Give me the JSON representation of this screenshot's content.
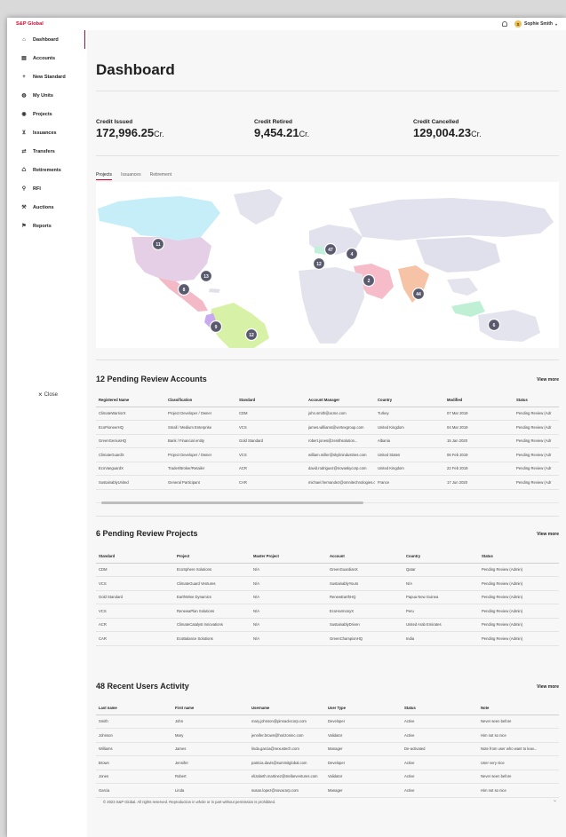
{
  "header": {
    "brand": "S&P Global",
    "user_initial": "S",
    "user_name": "Sophie Smith",
    "caret": "▾"
  },
  "sidebar": {
    "items": [
      {
        "label": "Dashboard",
        "icon": "home-icon",
        "glyph": "⌂"
      },
      {
        "label": "Accounts",
        "icon": "accounts-icon",
        "glyph": "▤"
      },
      {
        "label": "New Standard",
        "icon": "plus-icon",
        "glyph": "+"
      },
      {
        "label": "My Units",
        "icon": "units-icon",
        "glyph": "◍"
      },
      {
        "label": "Projects",
        "icon": "projects-icon",
        "glyph": "◉"
      },
      {
        "label": "Issuances",
        "icon": "cart-icon",
        "glyph": "⊻"
      },
      {
        "label": "Transfers",
        "icon": "transfer-icon",
        "glyph": "⇄"
      },
      {
        "label": "Retirements",
        "icon": "recycle-icon",
        "glyph": "♺"
      },
      {
        "label": "RFI",
        "icon": "rfi-icon",
        "glyph": "⚲"
      },
      {
        "label": "Auctions",
        "icon": "gavel-icon",
        "glyph": "⚒"
      },
      {
        "label": "Reports",
        "icon": "flag-icon",
        "glyph": "⚑"
      }
    ],
    "close_label": "Close"
  },
  "main": {
    "title": "Dashboard",
    "stats": [
      {
        "label": "Credit Issued",
        "value": "172,996.25",
        "unit": "Cr."
      },
      {
        "label": "Credit Retired",
        "value": "9,454.21",
        "unit": "Cr."
      },
      {
        "label": "Credit Cancelled",
        "value": "129,004.23",
        "unit": "Cr."
      }
    ],
    "tabs": [
      "Projects",
      "Issuances",
      "Retirement"
    ],
    "map_markers": [
      {
        "label": "11"
      },
      {
        "label": "13"
      },
      {
        "label": "8"
      },
      {
        "label": "9"
      },
      {
        "label": "12"
      },
      {
        "label": "47"
      },
      {
        "label": "4"
      },
      {
        "label": "12"
      },
      {
        "label": "2"
      },
      {
        "label": "44"
      },
      {
        "label": "6"
      }
    ]
  },
  "accounts": {
    "title": "12 Pending Review Accounts",
    "view_more": "View more",
    "columns": [
      "Registered Name",
      "Classification",
      "Standard",
      "Account Manager",
      "Country",
      "Modified",
      "Status"
    ],
    "rows": [
      [
        "ClimateWarriorX",
        "Project Developer / Owner",
        "CDM",
        "john.smith@acme.com",
        "Turkey",
        "07 Mar 2019",
        "Pending Review (Adr"
      ],
      [
        "EcoPioneerHQ",
        "Small / Medium Enterprise",
        "VCS",
        "james.williams@vertexgroup.com",
        "United Kingdom",
        "04 Mar 2019",
        "Pending Review (Adr"
      ],
      [
        "GreenGeniusHQ",
        "Bank / Financial entity",
        "Gold Standard",
        "robert.jones@zenithsolution...",
        "Albania",
        "15 Jan 2020",
        "Pending Review (Adr"
      ],
      [
        "ClimateGuardX",
        "Project Developer / Owner",
        "VCS",
        "william.miller@skylinindustries.com",
        "United States",
        "06 Feb 2019",
        "Pending Review (Adr"
      ],
      [
        "EcoVanguardX",
        "Trader/Broker/Retailer",
        "ACR",
        "david.rodriguez@novaskycorp.com",
        "United Kingdom",
        "22 Feb 2019",
        "Pending Review (Adr"
      ],
      [
        "SustainablyUnited",
        "General Participant",
        "CAR",
        "michael.hernandez@omnitechnologies.com",
        "France",
        "17 Jun 2020",
        "Pending Review (Adr"
      ]
    ]
  },
  "projects": {
    "title": "6 Pending Review Projects",
    "view_more": "View more",
    "columns": [
      "Standard",
      "Project",
      "Master Project",
      "Account",
      "Country",
      "Status"
    ],
    "rows": [
      [
        "CDM",
        "EcoSphere Solutions",
        "N/A",
        "GreenGuardianX",
        "Qatar",
        "Pending Review (Admin)"
      ],
      [
        "VCS",
        "ClimateGuard Ventures",
        "N/A",
        "SustainablyYours",
        "N/A",
        "Pending Review (Admin)"
      ],
      [
        "Gold Standard",
        "EarthWise Dynamics",
        "N/A",
        "RenewEarthHQ",
        "Papua New Guinea",
        "Pending Review (Admin)"
      ],
      [
        "VCS",
        "RenewaPlan Solutions",
        "N/A",
        "EcoHarmonyX",
        "Peru",
        "Pending Review (Admin)"
      ],
      [
        "ACR",
        "ClimateCatalyst Innovations",
        "N/A",
        "SustainablyDriven",
        "United Arab Emirates",
        "Pending Review (Admin)"
      ],
      [
        "CAR",
        "EcoBalance Solutions",
        "N/A",
        "GreenChampionHQ",
        "India",
        "Pending Review (Admin)"
      ]
    ]
  },
  "users": {
    "title": "48 Recent Users Activity",
    "view_more": "View more",
    "columns": [
      "Last name",
      "First name",
      "Username",
      "User Type",
      "Status",
      "Note"
    ],
    "rows": [
      [
        "Smith",
        "John",
        "mary.johnson@pinnaclecorp.com",
        "Developer",
        "Active",
        "Never seen before"
      ],
      [
        "Johnson",
        "Mary",
        "jennifer.brown@horizoninc.com",
        "Validator",
        "Active",
        "Him not so nice"
      ],
      [
        "Williams",
        "James",
        "linda.garcia@nexustech.com",
        "Manager",
        "De-activated",
        "Note from user who want to leav..."
      ],
      [
        "Brown",
        "Jennifer",
        "patricia.davis@summitglobal.com",
        "Developer",
        "Active",
        "User very nice"
      ],
      [
        "Jones",
        "Robert",
        "elizabeth.martinez@stellarventures.com",
        "Validator",
        "Active",
        "Never seen before"
      ],
      [
        "Garcia",
        "Linda",
        "susan.lopez@novacorp.com",
        "Manager",
        "Active",
        "Him not so nice"
      ]
    ]
  },
  "footer": {
    "text": "© 2023 S&P Global. All rights reserved. Reproduction in whole or in part without permission is prohibited.",
    "chevron": "⌄"
  },
  "colors": {
    "accent": "#d6002a",
    "marker": "#5a5a6e"
  }
}
